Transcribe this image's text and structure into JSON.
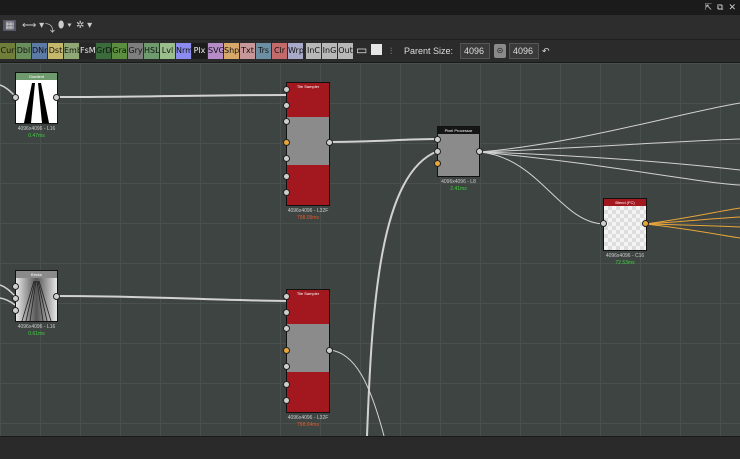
{
  "window": {
    "controls": [
      "⇱",
      "⧉",
      "✕"
    ]
  },
  "toolbar_top": {
    "items": [
      "▦",
      "⟷ ▾",
      "⤵",
      "⬮ ▾",
      "✲ ▾"
    ]
  },
  "toolbar_nodes": {
    "chips": [
      {
        "label": "Cur",
        "color": "#6f7f3a"
      },
      {
        "label": "Dbl",
        "color": "#6a8e5c"
      },
      {
        "label": "DNr",
        "color": "#5c7aa6"
      },
      {
        "label": "Dst",
        "color": "#c6b86a"
      },
      {
        "label": "Emb",
        "color": "#8fa875"
      },
      {
        "label": "FsM",
        "color": "#262626"
      },
      {
        "label": "GrD",
        "color": "#3b6b3b"
      },
      {
        "label": "Gra",
        "color": "#5b8e3e"
      },
      {
        "label": "Gry",
        "color": "#7e7e7e"
      },
      {
        "label": "HSL",
        "color": "#6e9a6e"
      },
      {
        "label": "Lvl",
        "color": "#9bbf8c"
      },
      {
        "label": "Nrm",
        "color": "#8c8cf0"
      },
      {
        "label": "Plx",
        "color": "#1b1b1b"
      },
      {
        "label": "SVG",
        "color": "#b58cc8"
      },
      {
        "label": "Shp",
        "color": "#d8a86a"
      },
      {
        "label": "Txt",
        "color": "#c89898"
      },
      {
        "label": "Trs",
        "color": "#6d8fa3"
      },
      {
        "label": "Clr",
        "color": "#c46a6a"
      },
      {
        "label": "Wrp",
        "color": "#a8a8c8"
      },
      {
        "label": "InC",
        "color": "#b8b8b8"
      },
      {
        "label": "InG",
        "color": "#b8b8b8"
      },
      {
        "label": "Out",
        "color": "#b8b8b8"
      }
    ],
    "parent_size_label": "Parent Size:",
    "parent_size_value": "4096",
    "size_value": "4096"
  },
  "nodes": {
    "gradient_top": {
      "title": "Gradient",
      "info": "4096x4096 - L16",
      "time": "0.47ms",
      "time_color": "#3fd03f"
    },
    "tile_sampler_1": {
      "title": "Tile Sampler",
      "info": "4096x4096 - L32F",
      "time": "798.09ms",
      "time_color": "#e05a2a"
    },
    "pixel_processor": {
      "title": "Pixel Processor",
      "info": "4096x4096 - L8",
      "time": "2.41ms",
      "time_color": "#3fd03f"
    },
    "blend": {
      "title": "Blend (FC)",
      "info": "4096x4096 - C16",
      "time": "72.53ms",
      "time_color": "#3fd03f"
    },
    "gradient_bottom": {
      "title": "Bricks",
      "info": "4096x4096 - L16",
      "time": "0.61ms",
      "time_color": "#3fd03f"
    },
    "tile_sampler_2": {
      "title": "Tile Sampler",
      "info": "4096x4096 - L32F",
      "time": "798.04ms",
      "time_color": "#e05a2a"
    }
  },
  "colors": {
    "accent_wire": "#e8a53a",
    "wire": "#d2d2d2",
    "node_red": "#a3181f"
  }
}
